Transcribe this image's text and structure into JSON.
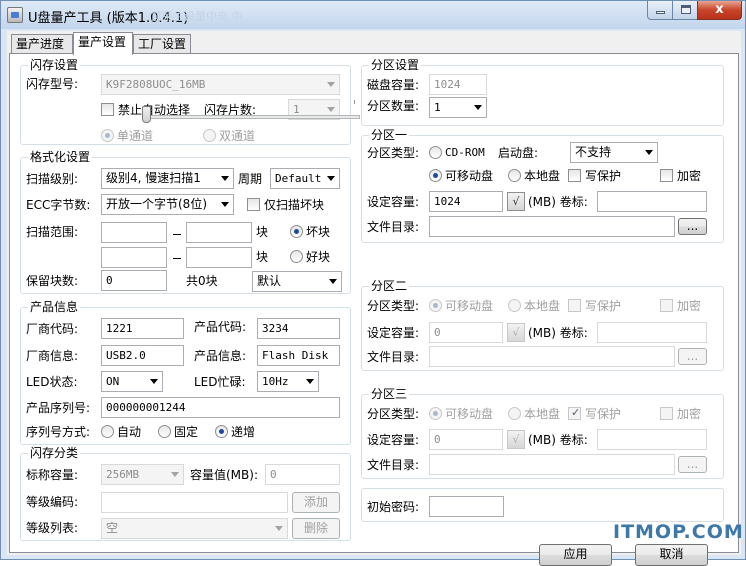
{
  "window": {
    "title": "U盘量产工具 (版本1.0.4.1)",
    "title_ghost": "慧荣主设量中电 中",
    "close_glyph": "x"
  },
  "tabs": [
    "量产进度",
    "量产设置",
    "工厂设置"
  ],
  "flash": {
    "group": "闪存设置",
    "model_label": "闪存型号:",
    "model_value": "K9F2808UOC_16MB",
    "disable_auto_label": "禁止自动选择",
    "chip_count_label": "闪存片数:",
    "chip_count_value": "1",
    "single_channel": "单通道",
    "dual_channel": "双通道"
  },
  "format": {
    "group": "格式化设置",
    "scan_level_label": "扫描级别:",
    "scan_level_value": "级别4, 慢速扫描1",
    "period_label": "周期",
    "period_value": "Default",
    "ecc_label": "ECC字节数:",
    "ecc_value": "开放一个字节(8位)",
    "scan_bad_only": "仅扫描坏块",
    "scan_range_label": "扫描范围:",
    "range_from_1": "",
    "range_to_1": "",
    "block_1": "块",
    "range_from_2": "",
    "range_to_2": "",
    "block_2": "块",
    "bad_block": "坏块",
    "good_block": "好块",
    "reserved_label": "保留块数:",
    "reserved_value": "0",
    "total_label": "共0块",
    "default_value": "默认"
  },
  "product": {
    "group": "产品信息",
    "vendor_code_label": "厂商代码:",
    "vendor_code_value": "1221",
    "product_code_label": "产品代码:",
    "product_code_value": "3234",
    "vendor_info_label": "厂商信息:",
    "vendor_info_value": "USB2.0",
    "product_info_label": "产品信息:",
    "product_info_value": "Flash Disk",
    "led_status_label": "LED状态:",
    "led_status_value": "ON",
    "led_busy_label": "LED忙碌:",
    "led_busy_value": "10Hz",
    "serial_label": "产品序列号:",
    "serial_value": "000000001244",
    "serial_mode_label": "序列号方式:",
    "mode_auto": "自动",
    "mode_fixed": "固定",
    "mode_incr": "递增"
  },
  "category": {
    "group": "闪存分类",
    "nominal_label": "标称容量:",
    "nominal_value": "256MB",
    "capacity_label": "容量值(MB):",
    "capacity_value": "0",
    "grade_code_label": "等级编码:",
    "grade_code_value": "",
    "add_button": "添加",
    "grade_list_label": "等级列表:",
    "grade_list_value": "空",
    "delete_button": "删除"
  },
  "partition": {
    "group": "分区设置",
    "disk_capacity_label": "磁盘容量:",
    "disk_capacity_value": "1024",
    "count_label": "分区数量:",
    "count_value": "1"
  },
  "p1": {
    "group": "分区一",
    "type_label": "分区类型:",
    "cdrom": "CD-ROM",
    "boot_label": "启动盘:",
    "boot_value": "不支持",
    "removable": "可移动盘",
    "local": "本地盘",
    "write_protect": "写保护",
    "encrypt": "加密",
    "capacity_label": "设定容量:",
    "capacity_value": "1024",
    "calc_glyph": "√",
    "mb_volume": "(MB) 卷标:",
    "volume_value": "",
    "dir_label": "文件目录:",
    "dir_value": "",
    "browse": "..."
  },
  "p2": {
    "group": "分区二",
    "type_label": "分区类型:",
    "removable": "可移动盘",
    "local": "本地盘",
    "write_protect": "写保护",
    "encrypt": "加密",
    "capacity_label": "设定容量:",
    "capacity_value": "0",
    "calc_glyph": "√",
    "mb_volume": "(MB) 卷标:",
    "volume_value": "",
    "dir_label": "文件目录:",
    "dir_value": "",
    "browse": "..."
  },
  "p3": {
    "group": "分区三",
    "type_label": "分区类型:",
    "removable": "可移动盘",
    "local": "本地盘",
    "write_protect": "写保护",
    "encrypt": "加密",
    "capacity_label": "设定容量:",
    "capacity_value": "0",
    "calc_glyph": "√",
    "mb_volume": "(MB) 卷标:",
    "volume_value": "",
    "dir_label": "文件目录:",
    "dir_value": "",
    "browse": "..."
  },
  "password": {
    "label": "初始密码:",
    "value": ""
  },
  "buttons": {
    "apply": "应用",
    "cancel": "取消"
  },
  "watermark": "ITMOP.COM",
  "check_glyph": "✓"
}
